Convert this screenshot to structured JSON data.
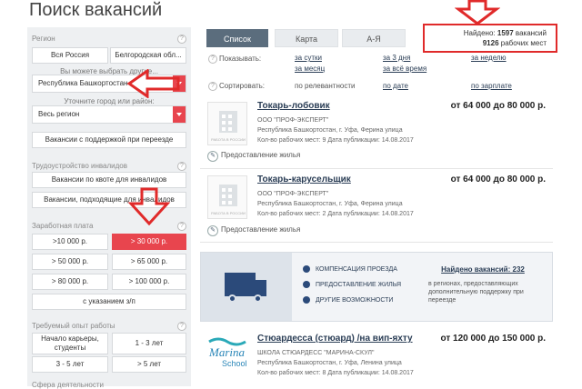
{
  "page_title": "Поиск вакансий",
  "sidebar": {
    "region_head": "Регион",
    "btn_all_russia": "Вся Россия",
    "btn_belgorod": "Белгородская обл...",
    "hint_choose": "Вы можете выбрать другие...",
    "region_select": "Республика Башкортостан",
    "hint_city": "Уточните город или район:",
    "city_select": "Весь регион",
    "btn_relocation": "Вакансии с поддержкой при переезде",
    "disabled_head": "Трудоустройство инвалидов",
    "btn_quota": "Вакансии по квоте для инвалидов",
    "btn_suitable": "Вакансии, подходящие для инвалидов",
    "salary_head": "Заработная плата",
    "salary": [
      ">10 000 р.",
      "> 30 000 р.",
      "> 50 000 р.",
      "> 65 000 р.",
      "> 80 000 р.",
      "> 100 000 р."
    ],
    "btn_with_salary": "с указанием з/п",
    "exp_head": "Требуемый опыт работы",
    "exp": [
      "Начало карьеры, студенты",
      "1 - 3 лет",
      "3 - 5 лет",
      "> 5 лет"
    ],
    "field_head": "Сфера деятельности"
  },
  "tabs": [
    "Список",
    "Карта",
    "А-Я"
  ],
  "found": {
    "label": "Найдено:",
    "vacancies_count": "1597",
    "vacancies_label": "вакансий",
    "places_count": "9126",
    "places_label": "рабочих мест"
  },
  "filters": {
    "show_label": "Показывать:",
    "show_options": [
      "за сутки",
      "за 3 дня",
      "за неделю",
      "за месяц",
      "за всё время"
    ],
    "sort_label": "Сортировать:",
    "sort_options": [
      "по релевантности",
      "по дате",
      "по зарплате"
    ]
  },
  "jobs": [
    {
      "title": "Токарь-лобовик",
      "salary": "от 64 000 до 80 000 р.",
      "company": "ООО \"ПРОФ-ЭКСПЕРТ\"",
      "location": "Республика Башкортостан, г. Уфа, Ферина улица",
      "meta": "Кол-во рабочих мест: 9  Дата публикации: 14.08.2017",
      "benefit": "Предоставление жилья",
      "logo_caption": "РАБОТА В РОССИИ"
    },
    {
      "title": "Токарь-карусельщик",
      "salary": "от 64 000 до 80 000 р.",
      "company": "ООО \"ПРОФ-ЭКСПЕРТ\"",
      "location": "Республика Башкортостан, г. Уфа, Ферина улица",
      "meta": "Кол-во рабочих мест: 2  Дата публикации: 14.08.2017",
      "benefit": "Предоставление жилья",
      "logo_caption": "РАБОТА В РОССИИ"
    },
    {
      "title": "Стюардесса (стюард) /на вип-яхту",
      "salary": "от 120 000 до 150 000 р.",
      "company": "ШКОЛА СТЮАРДЕСС \"МАРИНА-СКУЛ\"",
      "location": "Республика Башкортостан, г. Уфа, Ленина улица",
      "meta": "Кол-во рабочих мест: 8  Дата публикации: 14.08.2017",
      "logo_line1": "Marina",
      "logo_line2": "School"
    }
  ],
  "promo": {
    "features": [
      "Компенсация проезда",
      "Предоставление жилья",
      "Другие возможности"
    ],
    "found": "Найдено вакансий: 232",
    "desc": "в регионах, предоставляющих дополнительную поддержку при переезде"
  },
  "colors": {
    "accent": "#e8454e",
    "tab_active": "#5b6d7d",
    "link": "#2a3d55",
    "arrow": "#e02a2a"
  }
}
